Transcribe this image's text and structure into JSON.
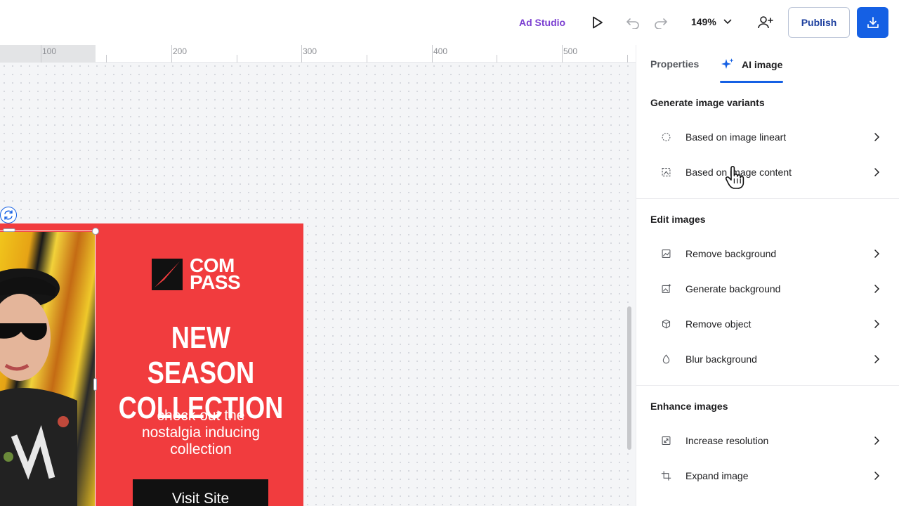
{
  "header": {
    "brand_label": "Ad Studio",
    "zoom_value": "149%",
    "publish_label": "Publish"
  },
  "ruler": {
    "labels": [
      "100",
      "200",
      "300",
      "400",
      "500"
    ]
  },
  "ad": {
    "logo_line1": "COM",
    "logo_line2": "PASS",
    "headline_line1": "NEW SEASON",
    "headline_line2": "COLLECTION",
    "subline_1": "check out the",
    "subline_2": "nostalgia inducing",
    "subline_3": "collection",
    "cta_label": "Visit Site",
    "background_color": "#f13c3e"
  },
  "panel": {
    "tabs": [
      {
        "label": "Properties",
        "active": false
      },
      {
        "label": "AI image",
        "active": true
      }
    ],
    "sections": [
      {
        "title": "Generate image variants",
        "items": [
          {
            "label": "Based on image lineart",
            "icon": "lineart-icon"
          },
          {
            "label": "Based on image content",
            "icon": "image-content-icon"
          }
        ]
      },
      {
        "title": "Edit images",
        "items": [
          {
            "label": "Remove background",
            "icon": "remove-background-icon"
          },
          {
            "label": "Generate background",
            "icon": "generate-background-icon"
          },
          {
            "label": "Remove object",
            "icon": "cube-icon"
          },
          {
            "label": "Blur background",
            "icon": "drop-icon"
          }
        ]
      },
      {
        "title": "Enhance images",
        "items": [
          {
            "label": "Increase resolution",
            "icon": "expand-arrows-icon"
          },
          {
            "label": "Expand image",
            "icon": "crop-icon"
          }
        ]
      }
    ]
  },
  "colors": {
    "accent": "#1560e4",
    "brand_purple": "#7b3fd1"
  }
}
